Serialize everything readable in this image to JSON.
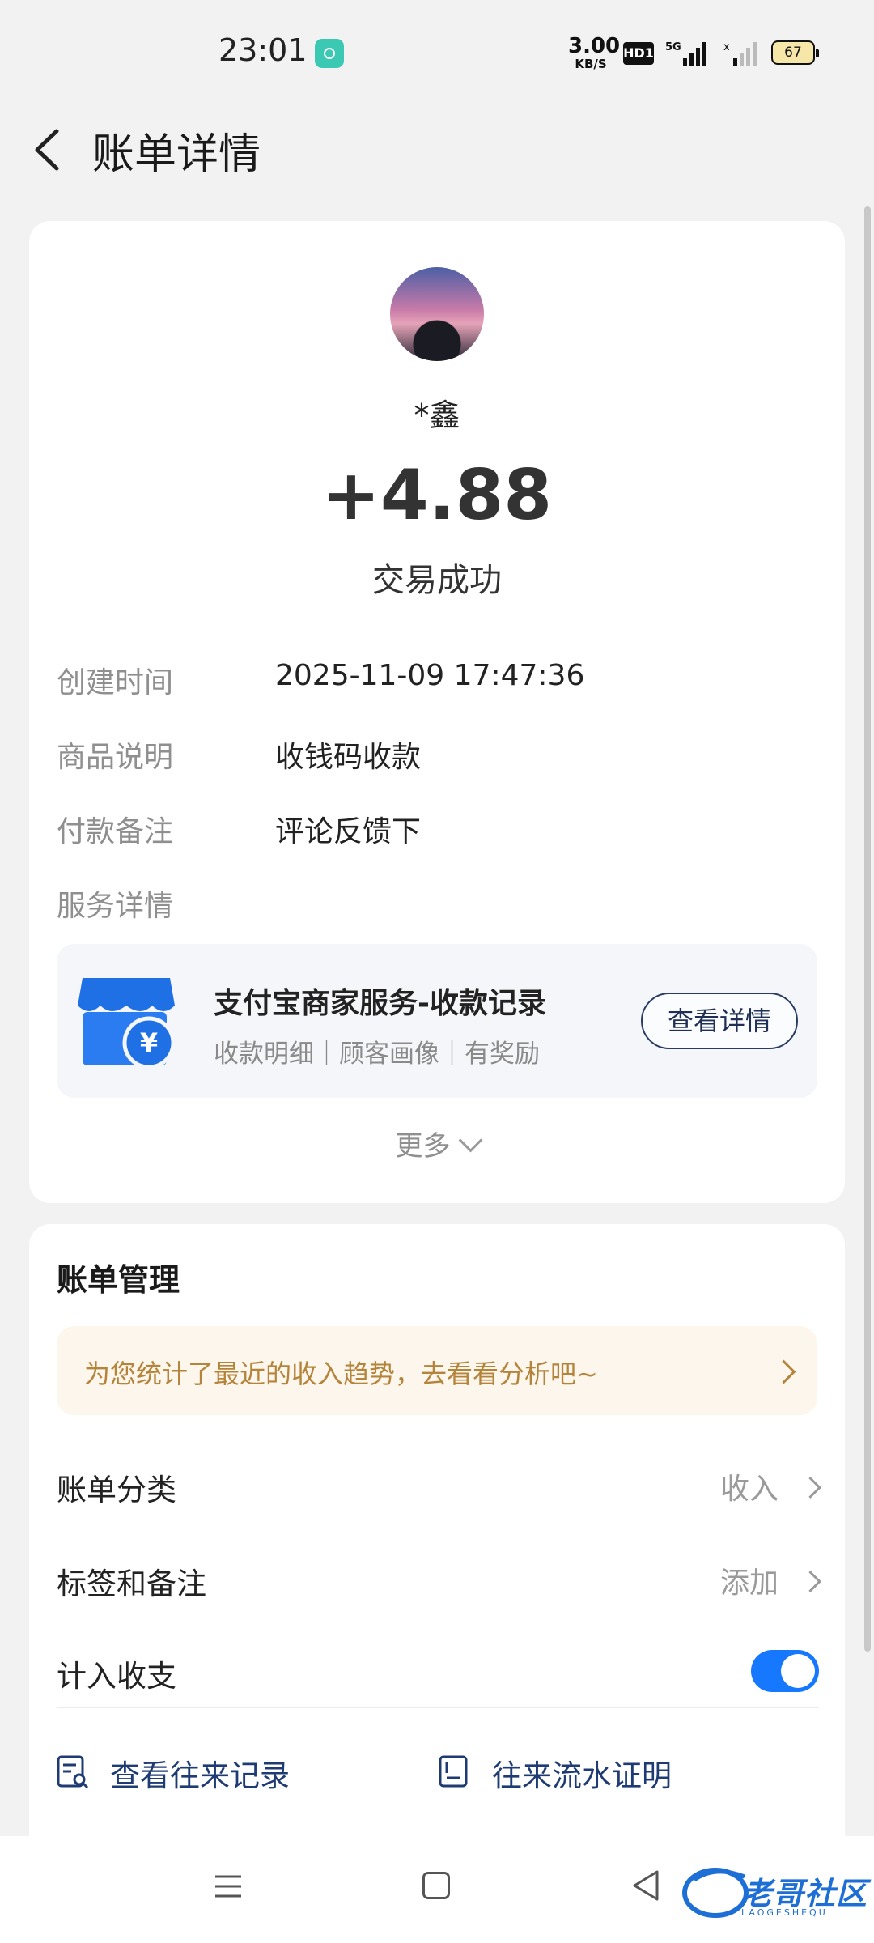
{
  "status_bar": {
    "time": "23:01",
    "net_speed_value": "3.00",
    "net_speed_unit": "KB/S",
    "hd_badge": "HD1",
    "network": "5G",
    "battery": "67"
  },
  "header": {
    "title": "账单详情",
    "back_icon": "chevron-left-icon"
  },
  "transaction": {
    "payer_name": "*鑫",
    "amount": "+4.88",
    "status": "交易成功"
  },
  "details": [
    {
      "label": "创建时间",
      "value": "2025-11-09 17:47:36"
    },
    {
      "label": "商品说明",
      "value": "收钱码收款"
    },
    {
      "label": "付款备注",
      "value": "评论反馈下"
    },
    {
      "label": "服务详情",
      "value": ""
    }
  ],
  "service": {
    "icon": "shop-yuan-icon",
    "title": "支付宝商家服务-收款记录",
    "subtitle": "收款明细｜顾客画像｜有奖励",
    "button_label": "查看详情"
  },
  "more_label": "更多",
  "bill_management": {
    "title": "账单管理",
    "tip": "为您统计了最近的收入趋势，去看看分析吧~",
    "rows": [
      {
        "label": "账单分类",
        "value": "收入"
      },
      {
        "label": "标签和备注",
        "value": "添加"
      },
      {
        "label": "计入收支",
        "toggle_on": true
      }
    ],
    "links": [
      {
        "label": "查看往来记录",
        "icon": "records-search-icon"
      },
      {
        "label": "往来流水证明",
        "icon": "statement-icon"
      }
    ]
  },
  "watermark": {
    "text": "老哥社区",
    "sub": "LAOGESHEQU"
  },
  "colors": {
    "accent_blue": "#1677ff",
    "link_blue": "#1f3b73",
    "tip_text": "#b5843b",
    "tip_bg": "#fdf6ec"
  }
}
